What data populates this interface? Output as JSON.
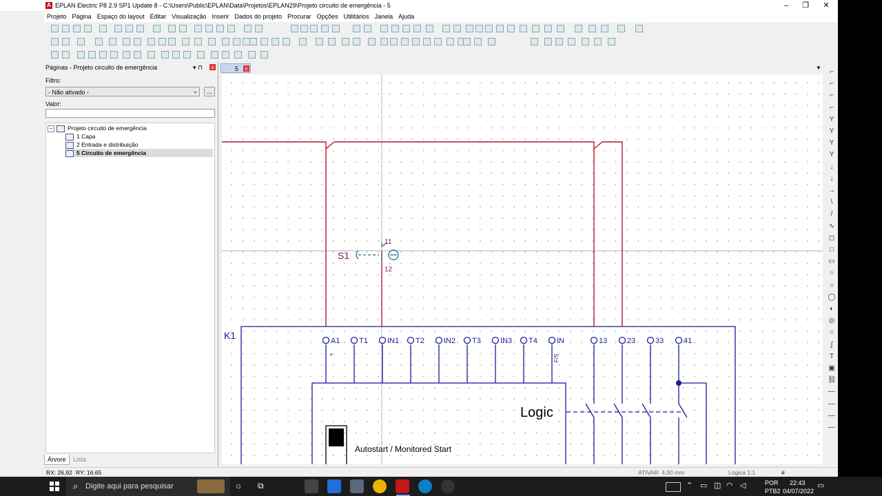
{
  "window": {
    "title": "EPLAN Electric P8 2.9 SP1 Update 8 - C:\\Users\\Public\\EPLAN\\Data\\Projetos\\EPLAN29\\Projeto circuito de emergência - 5",
    "min": "–",
    "max": "❐",
    "close": "✕",
    "restore_label": "#"
  },
  "menu": [
    "Projeto",
    "Página",
    "Espaço do layout",
    "Editar",
    "Visualização",
    "Inserir",
    "Dados do projeto",
    "Procurar",
    "Opções",
    "Utilitários",
    "Janela",
    "Ajuda"
  ],
  "panel": {
    "title": "Páginas - Projeto circuito de emergência",
    "pin": "▾  ⊓",
    "filter_label": "Filtro:",
    "filter_value": "- Não ativado -",
    "filter_button": "...",
    "value_label": "Valor:",
    "tree": {
      "root": "Projeto circuito de emergência",
      "pages": [
        "1 Capa",
        "2 Entrada e distribuição",
        "5 Circuito de emergência"
      ]
    },
    "tabs": [
      "Árvore",
      "Lista"
    ]
  },
  "document_tab": {
    "label": "5"
  },
  "schematic": {
    "switch_tag": "S1",
    "switch_top": "11",
    "switch_bottom": "12",
    "device_tag": "K1",
    "terminals": [
      "A1",
      "T1",
      "IN1",
      "T2",
      "IN2",
      "T3",
      "IN3",
      "T4",
      "IN",
      "13",
      "23",
      "33",
      "41"
    ],
    "fs_label": "F/S",
    "logic_label": "Logic",
    "autostart_label": "Autostart / Monitored Start",
    "plus": "+"
  },
  "status": {
    "rx": "RX: 26,92",
    "ry": "RY: 16,65",
    "activate": "ATIVAR: 4,00 mm",
    "logic": "Lógica 1:1",
    "hash": "#"
  },
  "taskbar": {
    "search_placeholder": "Digite aqui para pesquisar",
    "lang1": "POR",
    "lang2": "PTB2",
    "time": "22:43",
    "date": "04/07/2022"
  },
  "colors": {
    "wire_red": "#b0182a",
    "wire_blue": "#1a1a9c",
    "accent": "#c4161c"
  }
}
